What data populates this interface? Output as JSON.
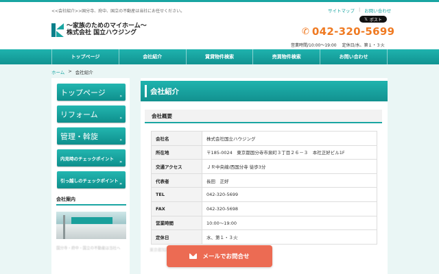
{
  "header": {
    "tagline": "<<会社紹介>>国分寺、府中、国立の不動産は当社にお任せください。",
    "logo_line1": "〜家族のためのマイホーム〜",
    "logo_line2": "株式会社 国立ハウジング",
    "util_links": [
      "サイトマップ",
      "お問い合わせ"
    ],
    "util_sep": "|",
    "x_post_label": "ポスト",
    "phone_icon": "phone-icon",
    "phone": "042-320-5699",
    "hours": "営業時間/10:00〜19:00",
    "closed": "定休日/水、第１・３火"
  },
  "nav": {
    "items": [
      "トップページ",
      "会社紹介",
      "賃貸物件検索",
      "売買物件検索",
      "お問い合わせ"
    ]
  },
  "breadcrumb": {
    "home": "ホーム",
    "sep": ">",
    "current": "会社紹介"
  },
  "sidebar": {
    "buttons": [
      "トップページ",
      "リフォーム",
      "管理・斡旋",
      "内見時のチェックポイント",
      "引っ越しのチェックポイント"
    ],
    "arrow": "»",
    "section_title": "会社案内",
    "caption": "国分寺・府中・国立の不動産は当社へ"
  },
  "main": {
    "title": "会社紹介",
    "subtitle": "会社概要",
    "rows": [
      {
        "key": "会社名",
        "value": "株式会社国立ハウジング"
      },
      {
        "key": "所在地",
        "value": "〒185-0024　東京都国分寺市泉町３丁目２６－３　本社正好ビル1F"
      },
      {
        "key": "交通アクセス",
        "value": "ＪＲ中央線/西国分寺 徒歩3分"
      },
      {
        "key": "代表者",
        "value": "長田　正好"
      },
      {
        "key": "TEL",
        "value": "042-320-5699"
      },
      {
        "key": "FAX",
        "value": "042-320-5698"
      },
      {
        "key": "営業時間",
        "value": "10:00〜19:00"
      },
      {
        "key": "定休日",
        "value": "水、第１・３火"
      }
    ],
    "blurred_text": "東京都知事（1）第　　号　公益社団法人全日本不動産協会"
  },
  "floating": {
    "mail_label": "メールでお問合せ",
    "mail_icon": "mail-icon"
  },
  "colors": {
    "teal": "#19a5a2",
    "orange": "#ef7a22",
    "mail_button": "#ec6b53"
  }
}
